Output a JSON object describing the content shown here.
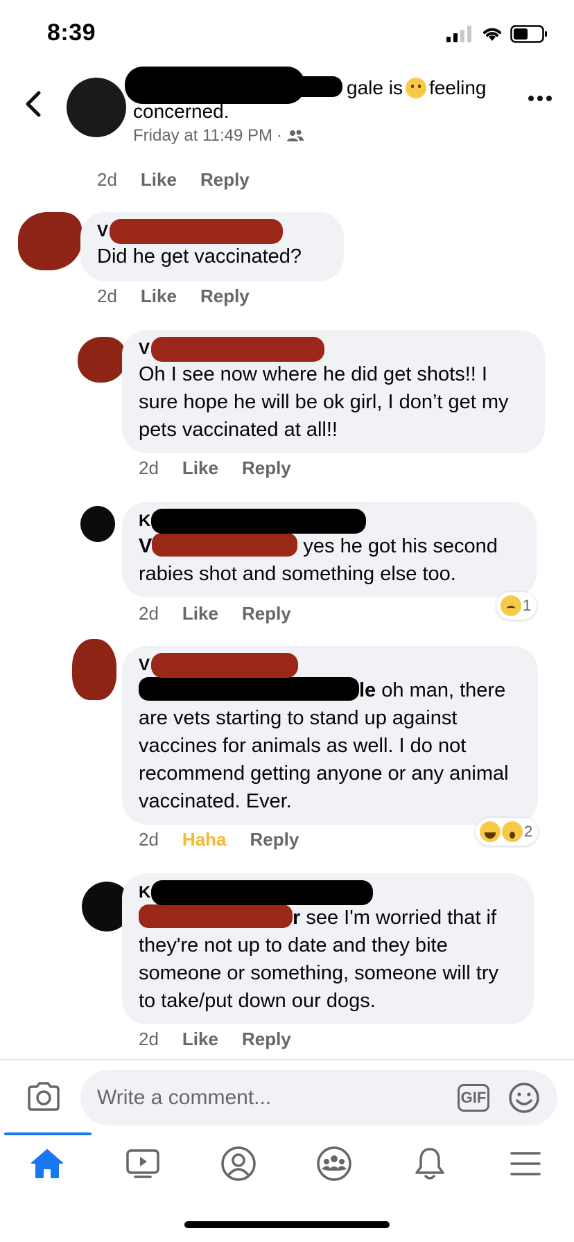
{
  "status_bar": {
    "time": "8:39"
  },
  "post_header": {
    "name_visible_fragment": "gale",
    "title_rest": "is",
    "feeling": "feeling",
    "title_line2": "concerned.",
    "timestamp": "Friday at 11:49 PM",
    "separator": "·",
    "audience_icon": "friends-icon"
  },
  "comments": [
    {
      "initial": "",
      "text": "",
      "age": "2d",
      "action": "Like",
      "reply": "Reply"
    },
    {
      "initial": "V",
      "text": "Did he get vaccinated?",
      "age": "2d",
      "action": "Like",
      "reply": "Reply"
    },
    {
      "initial": "V",
      "text": "Oh I see now where he did get shots!! I sure hope he will be ok girl, I don’t get my pets vaccinated at all!!",
      "age": "2d",
      "action": "Like",
      "reply": "Reply"
    },
    {
      "initial": "K",
      "mention_initial": "V",
      "text": "yes he got his second rabies shot and something else too.",
      "age": "2d",
      "action": "Like",
      "reply": "Reply",
      "reactions_count": "1",
      "reactions": [
        "sad-icon"
      ]
    },
    {
      "initial": "V",
      "mention_fragment": "le",
      "text_line1": "oh man, there",
      "text_rest": "are vets starting to stand up against vaccines for animals as well. I do not recommend getting anyone or any animal vaccinated. Ever.",
      "age": "2d",
      "action": "Haha",
      "reply": "Reply",
      "reactions_count": "2",
      "reactions": [
        "haha-icon",
        "wow-icon"
      ]
    },
    {
      "initial": "K",
      "mention_fragment": "r",
      "text_line1": "see I'm worried that if",
      "text_rest": "they're not up to date and they  bite someone or something, someone will try to take/put down our dogs.",
      "age": "2d",
      "action": "Like",
      "reply": "Reply"
    }
  ],
  "composer": {
    "placeholder": "Write a comment...",
    "gif_label": "GIF"
  },
  "colors": {
    "accent": "#1877f2",
    "bubble": "#f0f2f5",
    "haha": "#f7b928",
    "muted": "#65676b"
  },
  "tabs": [
    "home-icon",
    "watch-icon",
    "profile-icon",
    "groups-icon",
    "notifications-icon",
    "menu-icon"
  ]
}
